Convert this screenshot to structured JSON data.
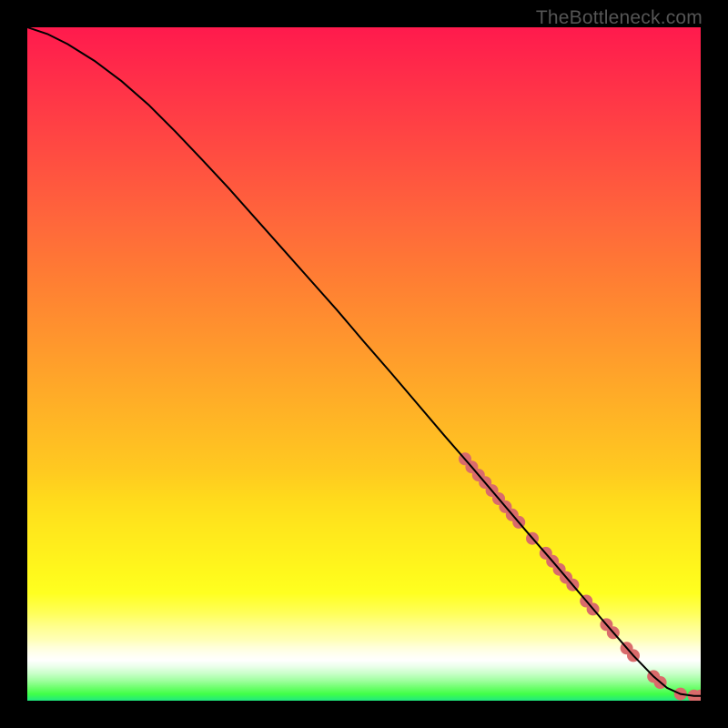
{
  "watermark": "TheBottleneck.com",
  "colors": {
    "curve": "#000000",
    "marker": "#d96b6b",
    "frame": "#000000"
  },
  "chart_data": {
    "type": "line",
    "title": "",
    "xlabel": "",
    "ylabel": "",
    "xlim": [
      0,
      100
    ],
    "ylim": [
      0,
      100
    ],
    "grid": false,
    "legend": false,
    "series": [
      {
        "name": "curve",
        "style": "line",
        "color": "#000000",
        "x": [
          0,
          3,
          6,
          10,
          14,
          18,
          22,
          26,
          30,
          34,
          38,
          42,
          46,
          50,
          54,
          58,
          62,
          66,
          70,
          74,
          78,
          82,
          86,
          90,
          93,
          95,
          97,
          99,
          100
        ],
        "y": [
          100,
          99,
          97.5,
          95,
          92,
          88.5,
          84.5,
          80.3,
          76,
          71.5,
          67,
          62.5,
          58,
          53.3,
          48.7,
          44,
          39.3,
          34.7,
          30,
          25.3,
          20.7,
          16,
          11.3,
          6.7,
          3.6,
          1.9,
          1,
          0.7,
          0.7
        ]
      },
      {
        "name": "highlight",
        "style": "scatter",
        "color": "#d96b6b",
        "x": [
          65,
          66,
          67,
          68,
          69,
          70,
          71,
          72,
          73,
          75,
          77,
          78,
          79,
          80,
          81,
          83,
          84,
          86,
          87,
          89,
          90,
          93,
          94,
          97,
          99,
          100
        ],
        "y": [
          35.9,
          34.7,
          33.5,
          32.4,
          31.2,
          30.0,
          28.8,
          27.6,
          26.5,
          24.1,
          21.9,
          20.7,
          19.5,
          18.3,
          17.2,
          14.8,
          13.6,
          11.3,
          10.1,
          7.8,
          6.7,
          3.6,
          2.7,
          1.0,
          0.7,
          0.7
        ]
      }
    ]
  }
}
